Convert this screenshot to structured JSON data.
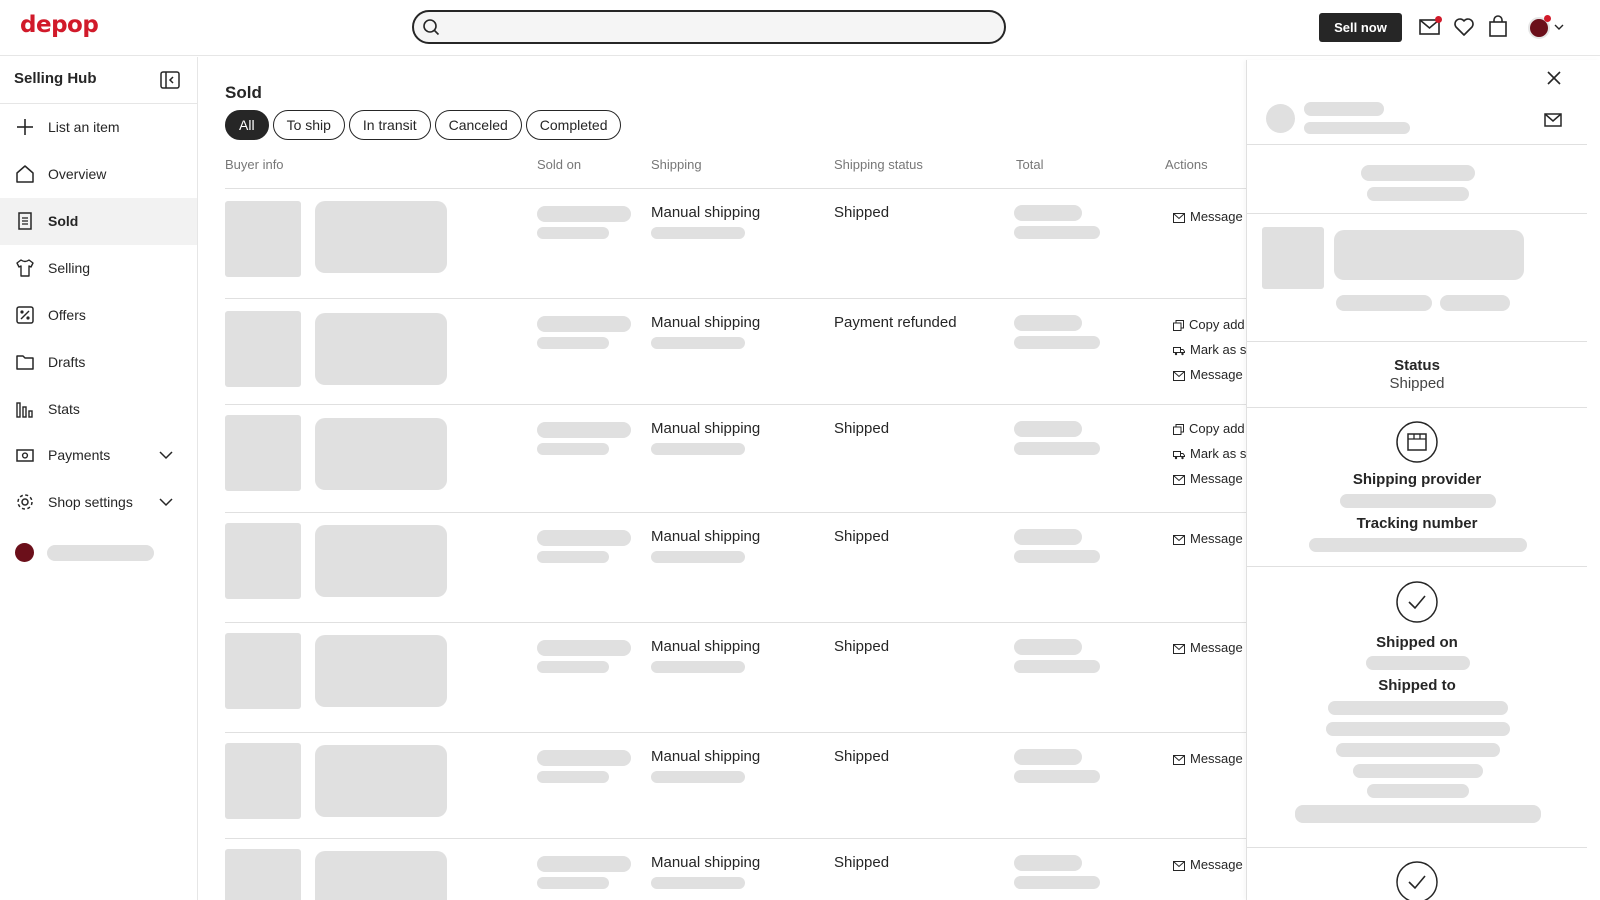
{
  "brand": {
    "logo": "depop",
    "accent": "#d11a2a"
  },
  "header": {
    "search_placeholder": "",
    "sell_now": "Sell now",
    "icons": [
      "search-icon",
      "mail-icon",
      "heart-icon",
      "bag-icon",
      "avatar",
      "chevron-down-icon"
    ]
  },
  "sidebar": {
    "title": "Selling Hub",
    "items": [
      {
        "label": "List an item",
        "icon": "plus-icon"
      },
      {
        "label": "Overview",
        "icon": "home-icon"
      },
      {
        "label": "Sold",
        "icon": "receipt-icon",
        "active": true
      },
      {
        "label": "Selling",
        "icon": "shirt-icon"
      },
      {
        "label": "Offers",
        "icon": "offers-icon"
      },
      {
        "label": "Drafts",
        "icon": "folder-icon"
      },
      {
        "label": "Stats",
        "icon": "stats-icon"
      },
      {
        "label": "Payments",
        "icon": "wallet-icon",
        "expandable": true
      },
      {
        "label": "Shop settings",
        "icon": "gear-icon",
        "expandable": true
      }
    ]
  },
  "main": {
    "title": "Sold",
    "filters": [
      "All",
      "To ship",
      "In transit",
      "Canceled",
      "Completed"
    ],
    "active_filter": "All",
    "columns": [
      "Buyer info",
      "Sold on",
      "Shipping",
      "Shipping status",
      "Total",
      "Actions"
    ],
    "rows": [
      {
        "shipping": "Manual shipping",
        "status": "Shipped",
        "actions": [
          "Message"
        ]
      },
      {
        "shipping": "Manual shipping",
        "status": "Payment refunded",
        "actions": [
          "Copy add",
          "Mark as s",
          "Message"
        ]
      },
      {
        "shipping": "Manual shipping",
        "status": "Shipped",
        "actions": [
          "Copy add",
          "Mark as s",
          "Message"
        ]
      },
      {
        "shipping": "Manual shipping",
        "status": "Shipped",
        "actions": [
          "Message"
        ]
      },
      {
        "shipping": "Manual shipping",
        "status": "Shipped",
        "actions": [
          "Message"
        ]
      },
      {
        "shipping": "Manual shipping",
        "status": "Shipped",
        "actions": [
          "Message"
        ]
      },
      {
        "shipping": "Manual shipping",
        "status": "Shipped",
        "actions": [
          "Message"
        ]
      }
    ]
  },
  "panel": {
    "status_label": "Status",
    "status_value": "Shipped",
    "shipping_provider_label": "Shipping provider",
    "tracking_number_label": "Tracking number",
    "shipped_on_label": "Shipped on",
    "shipped_to_label": "Shipped to"
  }
}
